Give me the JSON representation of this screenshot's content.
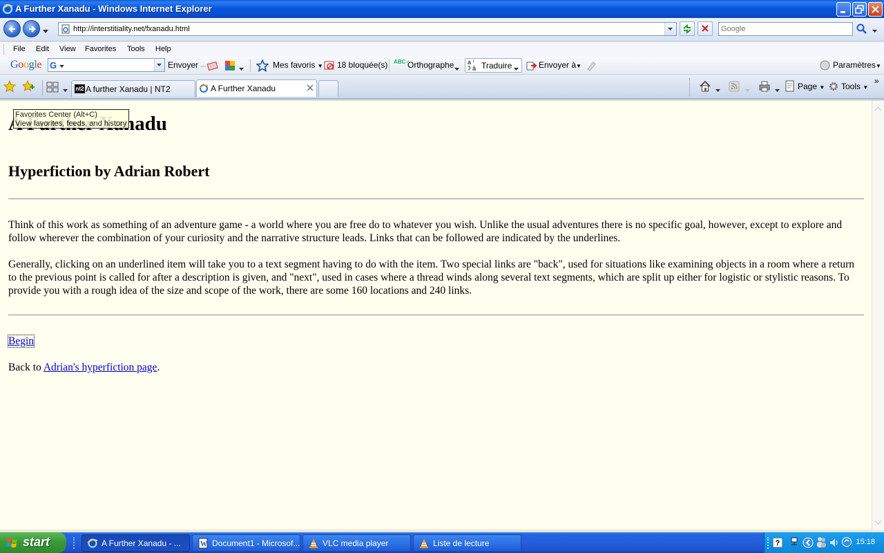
{
  "window": {
    "title": "A Further Xanadu - Windows Internet Explorer"
  },
  "address_bar": {
    "url": "http://interstitiality.net/fxanadu.html"
  },
  "search_box": {
    "placeholder": "Google"
  },
  "menu": {
    "items": [
      "File",
      "Edit",
      "View",
      "Favorites",
      "Tools",
      "Help"
    ]
  },
  "google_toolbar": {
    "logo": "Google",
    "envoyer_label": "Envoyer",
    "mes_favoris": "Mes favoris",
    "blocked_count": "18 bloquée(s)",
    "orthographe": "Orthographe",
    "traduire": "Traduire",
    "envoyer_a": "Envoyer à",
    "parametres": "Paramètres"
  },
  "tabs": [
    {
      "label": "A further Xanadu | NT2",
      "active": false
    },
    {
      "label": "A Further Xanadu",
      "active": true
    }
  ],
  "command_bar": {
    "page_label": "Page",
    "tools_label": "Tools"
  },
  "tooltip": {
    "line1": "Favorites Center (Alt+C)",
    "line2": "View favorites, feeds, and history"
  },
  "page": {
    "heading": "A Further Xanadu",
    "subheading": "Hyperfiction by Adrian Robert",
    "paragraph1": "Think of this work as something of an adventure game - a world where you are free do to whatever you wish. Unlike the usual adventures there is no specific goal, however, except to explore and follow wherever the combination of your curiosity and the narrative structure leads. Links that can be followed are indicated by the underlines.",
    "paragraph2": "Generally, clicking on an underlined item will take you to a text segment having to do with the item. Two special links are \"back\", used for situations like examining objects in a room where a return to the previous point is called for after a description is given, and \"next\", used in cases where a thread winds along several text segments, which are split up either for logistic or stylistic reasons. To provide you with a rough idea of the size and scope of the work, there are some 160 locations and 240 links.",
    "begin_link": "Begin",
    "back_prefix": "Back to ",
    "back_link": "Adrian's hyperfiction page",
    "back_suffix": "."
  },
  "taskbar": {
    "start_label": "start",
    "tasks": [
      {
        "label": "A Further Xanadu - ...",
        "active": true
      },
      {
        "label": "Document1 - Microsof...",
        "active": false
      },
      {
        "label": "VLC media player",
        "active": false
      },
      {
        "label": "Liste de lecture",
        "active": false
      }
    ],
    "clock": "15:18"
  },
  "colors": {
    "page_background": "#ffffef",
    "link": "#0000cc",
    "titlebar": "#0757df",
    "taskbar": "#245edb",
    "start_button": "#3a9a38"
  }
}
